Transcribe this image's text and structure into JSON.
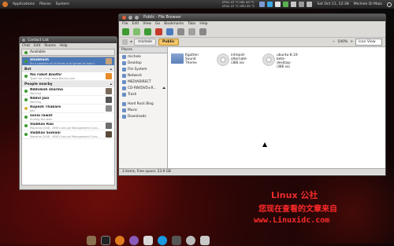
{
  "top_panel": {
    "menus": [
      "Applications",
      "Places",
      "System"
    ],
    "sensors": "CPU1 47 °C HD: 40 °C",
    "sensors2": "CPU2 47 °C GPU 55 °C",
    "clock": "Sat Oct 11, 12:38",
    "user": "Michele Di Maio"
  },
  "contact_list": {
    "title": "Contact List",
    "menu": [
      "Chat",
      "Edit",
      "Rooms",
      "Help"
    ],
    "status": "Available",
    "top_contacts": [
      {
        "name": "Shubhesh",
        "status": "It's a problem of all times is to ignore all man's"
      }
    ],
    "groups": [
      {
        "name": "Bot",
        "contacts": [
          {
            "name": "fbs robot Anothr",
            "status": "Type? for Help! www.Bot2ny.com"
          }
        ]
      },
      {
        "name": "People nearby",
        "contacts": [
          {
            "name": "Nikhilesh sharma",
            "status": "Working"
          },
          {
            "name": "Nikhil Jain",
            "status": "Working"
          },
          {
            "name": "Rupesh Thakare",
            "status": "Idle"
          },
          {
            "name": "sonia rawat",
            "status": "Surfing the web"
          },
          {
            "name": "Vaibhav Rao",
            "status": "Macaroo 2008 - IMIK's Annual Management Conc..."
          },
          {
            "name": "Vaibhav Somani",
            "status": "Macaroo 2008 - IMIK's Annual Management Conc..."
          }
        ]
      }
    ]
  },
  "file_browser": {
    "title": "Public - File Browser",
    "menu": [
      "File",
      "Edit",
      "View",
      "Go",
      "Bookmarks",
      "Tabs",
      "Help"
    ],
    "path": [
      "michele",
      "Public"
    ],
    "zoom": "100%",
    "view_mode": "Icon View",
    "places_label": "Places",
    "places": [
      "michele",
      "Desktop",
      "File System",
      "Network",
      "MEDIADIRECT",
      "CD-RW/DVD±R...",
      "Trash",
      "Hard Rock Blog",
      "Music",
      "Downloads"
    ],
    "files": [
      {
        "name": "Kgutten Sound Theme",
        "kind": "folder"
      },
      {
        "name": "intrepid-alternate-i386.iso",
        "kind": "disc"
      },
      {
        "name": "ubuntu-8.10-beta-desktop-i386.iso",
        "kind": "disc"
      }
    ],
    "status": "3 items, Free space: 23.9 GB"
  },
  "watermark": {
    "line1": "Linux 公社",
    "line2": "您现在查看的文章来自",
    "line3": "www.Linuxidc.com"
  }
}
